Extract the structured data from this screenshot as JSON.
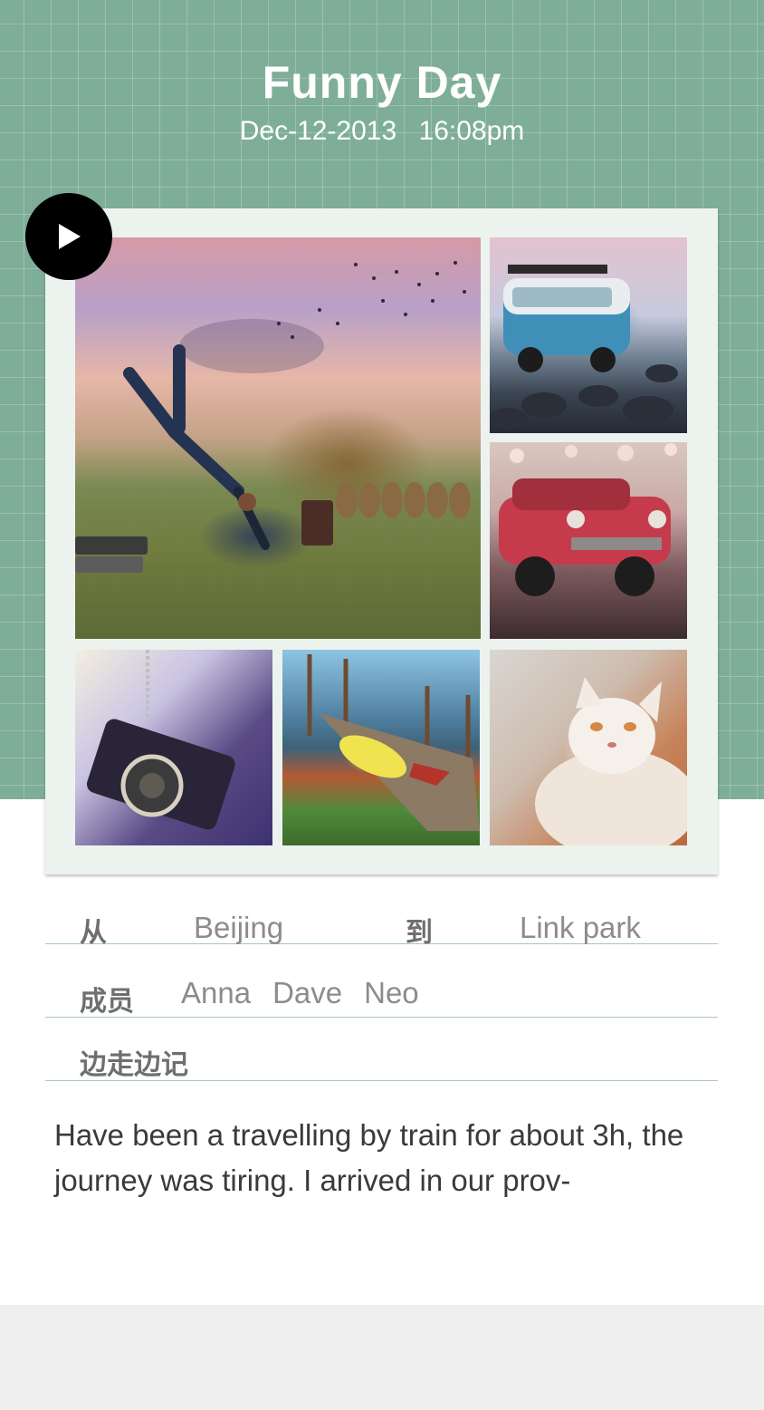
{
  "header": {
    "title": "Funny Day",
    "date": "Dec-12-2013",
    "time": "16:08pm"
  },
  "photos": [
    {
      "name": "photo-falling-man",
      "subject": "man falling over suitcases at sunset field"
    },
    {
      "name": "photo-blue-van",
      "subject": "toy blue van on rocks"
    },
    {
      "name": "photo-red-car",
      "subject": "toy red car"
    },
    {
      "name": "photo-camera",
      "subject": "camera pendant"
    },
    {
      "name": "photo-dock",
      "subject": "dock with yellow boat"
    },
    {
      "name": "photo-cat",
      "subject": "white cat"
    }
  ],
  "info": {
    "from_label": "从",
    "from_value": "Beijing",
    "to_label": "到",
    "to_value": "Link park",
    "members_label": "成员",
    "members": [
      "Anna",
      "Dave",
      "Neo"
    ],
    "notes_label": "边走边记"
  },
  "note": {
    "text": "Have been a travelling by train for about 3h, the journey was tiring. I arrived in our prov-"
  },
  "colors": {
    "header_green": "#7fae98",
    "card_bg": "#ecf3ef",
    "divider": "#a9c9bd"
  }
}
